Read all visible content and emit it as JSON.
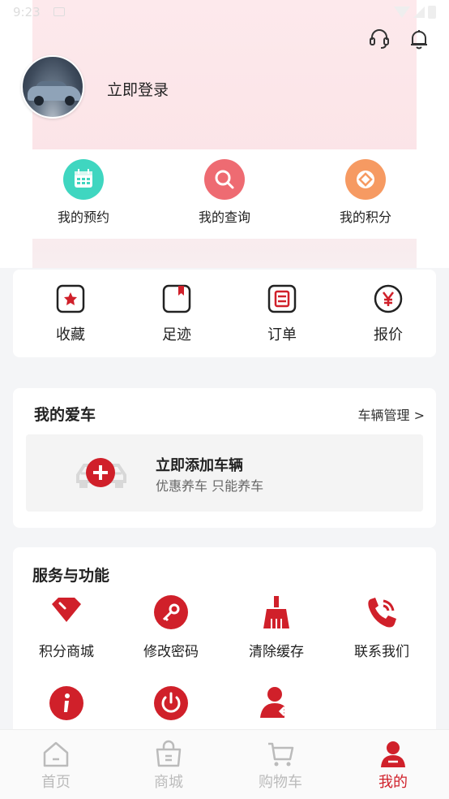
{
  "status_bar": {
    "time": "9:23"
  },
  "header": {
    "login_text": "立即登录"
  },
  "quick_actions": [
    {
      "label": "我的预约",
      "icon": "calendar-icon",
      "color": "#3fd6c0"
    },
    {
      "label": "我的查询",
      "icon": "search-icon",
      "color": "#ee6b72"
    },
    {
      "label": "我的积分",
      "icon": "points-icon",
      "color": "#f69a62"
    }
  ],
  "tools": [
    {
      "label": "收藏",
      "icon": "star-icon"
    },
    {
      "label": "足迹",
      "icon": "bookmark-icon"
    },
    {
      "label": "订单",
      "icon": "order-list-icon"
    },
    {
      "label": "报价",
      "icon": "yen-icon"
    }
  ],
  "my_car": {
    "title": "我的爱车",
    "manage_label": "车辆管理 >",
    "add_title": "立即添加车辆",
    "add_subtitle": "优惠养车 只能养车"
  },
  "services": {
    "title": "服务与功能",
    "items": [
      {
        "label": "积分商城",
        "icon": "diamond-icon"
      },
      {
        "label": "修改密码",
        "icon": "key-icon"
      },
      {
        "label": "清除缓存",
        "icon": "broom-icon"
      },
      {
        "label": "联系我们",
        "icon": "phone-icon"
      }
    ]
  },
  "tabbar": [
    {
      "label": "首页",
      "icon": "home-icon",
      "active": false
    },
    {
      "label": "商城",
      "icon": "shop-bag-icon",
      "active": false
    },
    {
      "label": "购物车",
      "icon": "cart-icon",
      "active": false
    },
    {
      "label": "我的",
      "icon": "profile-icon",
      "active": true
    }
  ],
  "colors": {
    "accent": "#d0202a",
    "inactive": "#bbbbbb"
  }
}
